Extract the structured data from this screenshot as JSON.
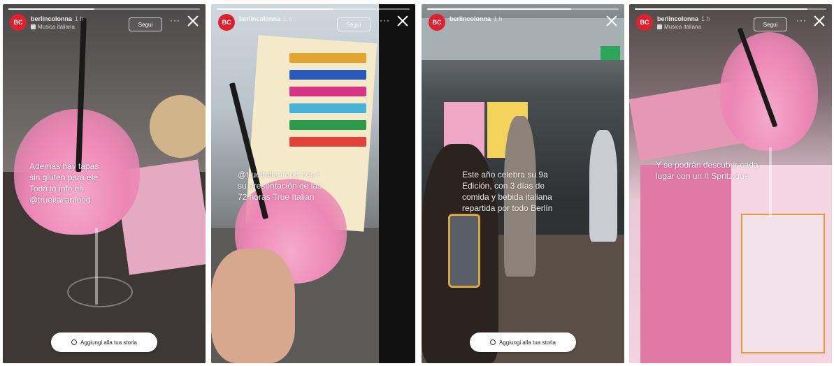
{
  "stories": [
    {
      "progress": 0.45,
      "avatar_text": "BC",
      "username": "berlincolonna",
      "time": "1 h",
      "subtitle": "Musica italiana",
      "follow_label": "Segui",
      "more_label": "···",
      "caption": "Ademas hay tapas\nsin gluten para ele\nToda la info en\n@trueitalianfood",
      "add_story_label": "Aggiungi alla tua storia"
    },
    {
      "progress": 0.6,
      "avatar_text": "BC",
      "username": "berlincolonna",
      "time": "1 h",
      "subtitle": "",
      "follow_label": "Segui",
      "more_label": "···",
      "caption": "@trueitalianfood nos i\nsu presentación de las\n72 horas True Italian"
    },
    {
      "progress": 0.75,
      "avatar_text": "BC",
      "username": "berlincolonna",
      "time": "1 h",
      "subtitle": "",
      "caption": "Este año celebra su 9a\nEdición, con 3 días de\ncomida y bebida italiana\nrepartida por todo Berlín",
      "add_story_label": "Aggiungi alla tua storia"
    },
    {
      "progress": 0.9,
      "avatar_text": "BC",
      "username": "berlincolonna",
      "time": "1 h",
      "subtitle": "Musica italiana",
      "follow_label": "Segui",
      "more_label": "···",
      "caption": "Y se podrán descubrir cada\nlugar con un # Spritz que"
    }
  ],
  "colors": {
    "brand_red": "#e0202f",
    "drink_pink": "#ec86b4"
  },
  "icons": [
    "close-icon",
    "more-icon",
    "music-icon",
    "add-story-icon"
  ]
}
